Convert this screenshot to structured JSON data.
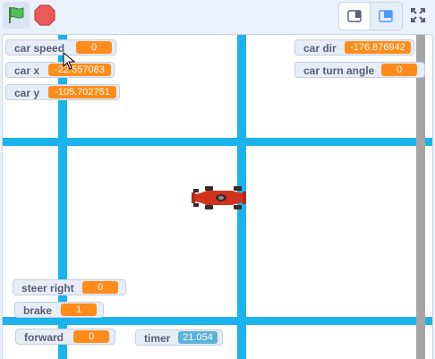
{
  "toolbar": {
    "green_flag_icon": "green-flag-icon",
    "stop_icon": "stop-sign-icon",
    "small_stage_icon": "small-stage-icon",
    "large_stage_icon": "large-stage-icon",
    "fullscreen_icon": "fullscreen-icon"
  },
  "colors": {
    "road": "#1ab3ec",
    "wall": "#a5a5a5",
    "monitor_value": "#ff8c1a",
    "timer_value": "#5cb1d6",
    "car_body": "#d0321c"
  },
  "monitors": {
    "car_speed": {
      "label": "car speed",
      "value": "0"
    },
    "car_x": {
      "label": "car x",
      "value": "-22.557083"
    },
    "car_y": {
      "label": "car y",
      "value": "-105.702751"
    },
    "car_dir": {
      "label": "car dir",
      "value": "-176.876942"
    },
    "car_turn_angle": {
      "label": "car turn angle",
      "value": "0"
    },
    "steer_right": {
      "label": "steer right",
      "value": "0"
    },
    "brake": {
      "label": "brake",
      "value": "1"
    },
    "forward": {
      "label": "forward",
      "value": "0"
    },
    "timer": {
      "label": "timer",
      "value": "21.054"
    }
  },
  "sprite": {
    "name_icon": "race-car-icon"
  }
}
